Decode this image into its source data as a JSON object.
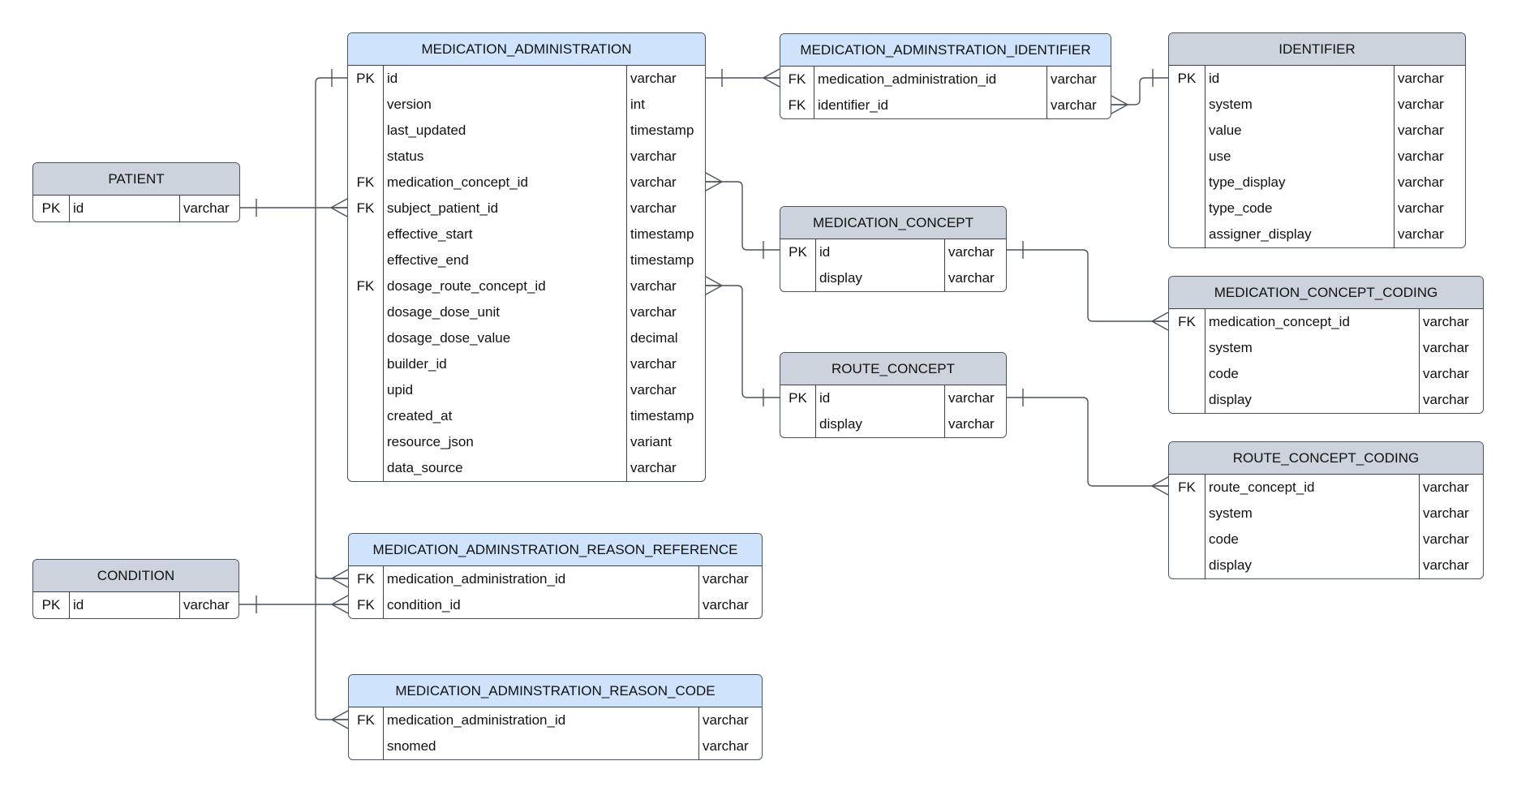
{
  "diagram_type": "entity-relationship",
  "colors": {
    "header_blue": "#cfe3fd",
    "header_gray": "#cdd3dc",
    "border": "#3a414a"
  },
  "tables": [
    {
      "name": "MEDICATION_ADMINISTRATION",
      "header": "blue",
      "rows": [
        {
          "key": "PK",
          "field": "id",
          "type": "varchar"
        },
        {
          "key": "",
          "field": "version",
          "type": "int"
        },
        {
          "key": "",
          "field": "last_updated",
          "type": "timestamp"
        },
        {
          "key": "",
          "field": "status",
          "type": "varchar"
        },
        {
          "key": "FK",
          "field": "medication_concept_id",
          "type": "varchar"
        },
        {
          "key": "FK",
          "field": "subject_patient_id",
          "type": "varchar"
        },
        {
          "key": "",
          "field": "effective_start",
          "type": "timestamp"
        },
        {
          "key": "",
          "field": "effective_end",
          "type": "timestamp"
        },
        {
          "key": "FK",
          "field": "dosage_route_concept_id",
          "type": "varchar"
        },
        {
          "key": "",
          "field": "dosage_dose_unit",
          "type": "varchar"
        },
        {
          "key": "",
          "field": "dosage_dose_value",
          "type": "decimal"
        },
        {
          "key": "",
          "field": "builder_id",
          "type": "varchar"
        },
        {
          "key": "",
          "field": "upid",
          "type": "varchar"
        },
        {
          "key": "",
          "field": "created_at",
          "type": "timestamp"
        },
        {
          "key": "",
          "field": "resource_json",
          "type": "variant"
        },
        {
          "key": "",
          "field": "data_source",
          "type": "varchar"
        }
      ]
    },
    {
      "name": "PATIENT",
      "header": "gray",
      "rows": [
        {
          "key": "PK",
          "field": "id",
          "type": "varchar"
        }
      ]
    },
    {
      "name": "MEDICATION_ADMINSTRATION_IDENTIFIER",
      "header": "blue",
      "rows": [
        {
          "key": "FK",
          "field": "medication_administration_id",
          "type": "varchar"
        },
        {
          "key": "FK",
          "field": "identifier_id",
          "type": "varchar"
        }
      ]
    },
    {
      "name": "IDENTIFIER",
      "header": "gray",
      "rows": [
        {
          "key": "PK",
          "field": "id",
          "type": "varchar"
        },
        {
          "key": "",
          "field": "system",
          "type": "varchar"
        },
        {
          "key": "",
          "field": "value",
          "type": "varchar"
        },
        {
          "key": "",
          "field": "use",
          "type": "varchar"
        },
        {
          "key": "",
          "field": "type_display",
          "type": "varchar"
        },
        {
          "key": "",
          "field": "type_code",
          "type": "varchar"
        },
        {
          "key": "",
          "field": "assigner_display",
          "type": "varchar"
        }
      ]
    },
    {
      "name": "MEDICATION_CONCEPT",
      "header": "gray",
      "rows": [
        {
          "key": "PK",
          "field": "id",
          "type": "varchar"
        },
        {
          "key": "",
          "field": "display",
          "type": "varchar"
        }
      ]
    },
    {
      "name": "MEDICATION_CONCEPT_CODING",
      "header": "gray",
      "rows": [
        {
          "key": "FK",
          "field": "medication_concept_id",
          "type": "varchar"
        },
        {
          "key": "",
          "field": "system",
          "type": "varchar"
        },
        {
          "key": "",
          "field": "code",
          "type": "varchar"
        },
        {
          "key": "",
          "field": "display",
          "type": "varchar"
        }
      ]
    },
    {
      "name": "ROUTE_CONCEPT",
      "header": "gray",
      "rows": [
        {
          "key": "PK",
          "field": "id",
          "type": "varchar"
        },
        {
          "key": "",
          "field": "display",
          "type": "varchar"
        }
      ]
    },
    {
      "name": "ROUTE_CONCEPT_CODING",
      "header": "gray",
      "rows": [
        {
          "key": "FK",
          "field": "route_concept_id",
          "type": "varchar"
        },
        {
          "key": "",
          "field": "system",
          "type": "varchar"
        },
        {
          "key": "",
          "field": "code",
          "type": "varchar"
        },
        {
          "key": "",
          "field": "display",
          "type": "varchar"
        }
      ]
    },
    {
      "name": "MEDICATION_ADMINSTRATION_REASON_REFERENCE",
      "header": "blue",
      "rows": [
        {
          "key": "FK",
          "field": "medication_administration_id",
          "type": "varchar"
        },
        {
          "key": "FK",
          "field": "condition_id",
          "type": "varchar"
        }
      ]
    },
    {
      "name": "CONDITION",
      "header": "gray",
      "rows": [
        {
          "key": "PK",
          "field": "id",
          "type": "varchar"
        }
      ]
    },
    {
      "name": "MEDICATION_ADMINSTRATION_REASON_CODE",
      "header": "blue",
      "rows": [
        {
          "key": "FK",
          "field": "medication_administration_id",
          "type": "varchar"
        },
        {
          "key": "",
          "field": "snomed",
          "type": "varchar"
        }
      ]
    }
  ],
  "relationships": [
    {
      "from": "MEDICATION_ADMINISTRATION.id",
      "to": "MEDICATION_ADMINSTRATION_IDENTIFIER.medication_administration_id",
      "cardinality": "one-to-many"
    },
    {
      "from": "IDENTIFIER.id",
      "to": "MEDICATION_ADMINSTRATION_IDENTIFIER.identifier_id",
      "cardinality": "one-to-many"
    },
    {
      "from": "PATIENT.id",
      "to": "MEDICATION_ADMINISTRATION.subject_patient_id",
      "cardinality": "one-to-many"
    },
    {
      "from": "MEDICATION_CONCEPT.id",
      "to": "MEDICATION_ADMINISTRATION.medication_concept_id",
      "cardinality": "one-to-many"
    },
    {
      "from": "ROUTE_CONCEPT.id",
      "to": "MEDICATION_ADMINISTRATION.dosage_route_concept_id",
      "cardinality": "one-to-many"
    },
    {
      "from": "MEDICATION_CONCEPT.id",
      "to": "MEDICATION_CONCEPT_CODING.medication_concept_id",
      "cardinality": "one-to-many"
    },
    {
      "from": "ROUTE_CONCEPT.id",
      "to": "ROUTE_CONCEPT_CODING.route_concept_id",
      "cardinality": "one-to-many"
    },
    {
      "from": "MEDICATION_ADMINISTRATION.id",
      "to": "MEDICATION_ADMINSTRATION_REASON_REFERENCE.medication_administration_id",
      "cardinality": "one-to-many"
    },
    {
      "from": "CONDITION.id",
      "to": "MEDICATION_ADMINSTRATION_REASON_REFERENCE.condition_id",
      "cardinality": "one-to-many"
    },
    {
      "from": "MEDICATION_ADMINISTRATION.id",
      "to": "MEDICATION_ADMINSTRATION_REASON_CODE.medication_administration_id",
      "cardinality": "one-to-many"
    }
  ]
}
